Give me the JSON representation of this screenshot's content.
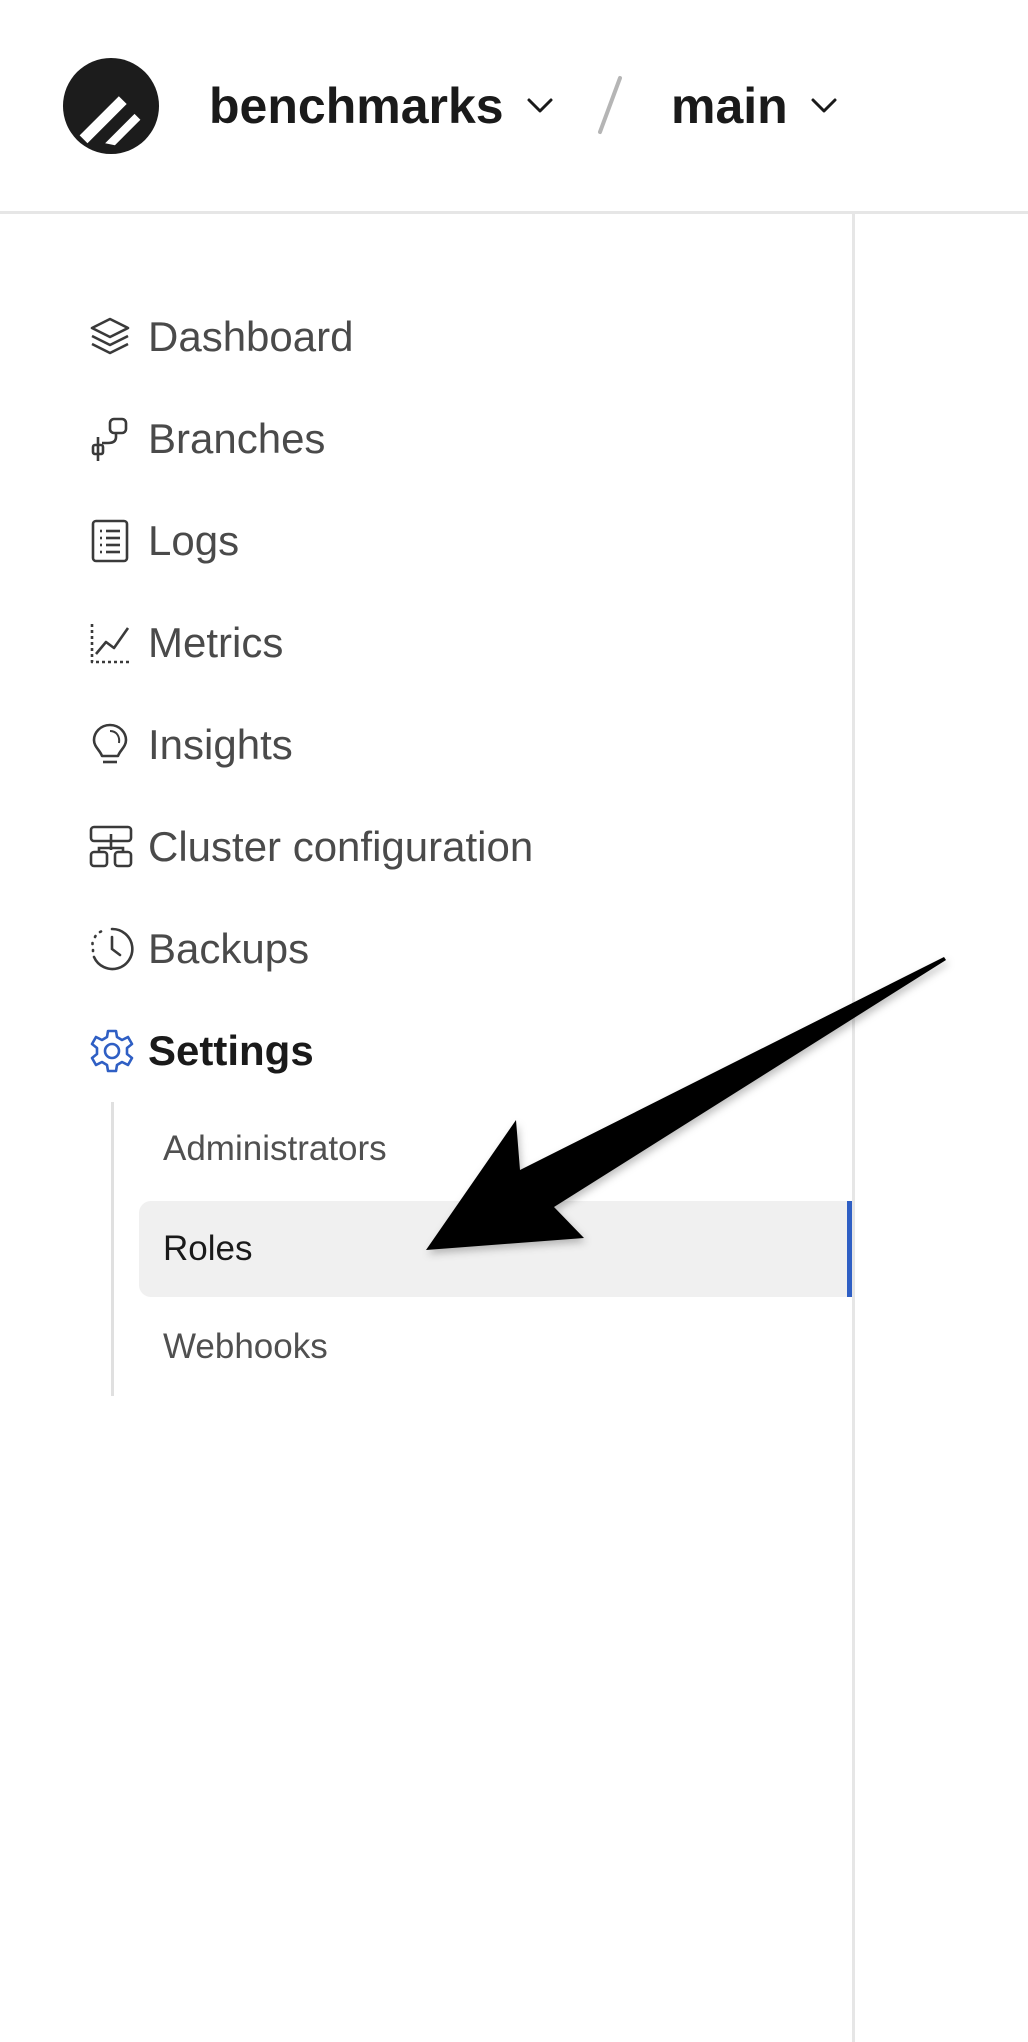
{
  "header": {
    "org_name": "benchmarks",
    "separator": "/",
    "branch_name": "main"
  },
  "sidebar": {
    "items": [
      {
        "label": "Dashboard",
        "icon": "layers-icon"
      },
      {
        "label": "Branches",
        "icon": "branch-icon"
      },
      {
        "label": "Logs",
        "icon": "document-list-icon"
      },
      {
        "label": "Metrics",
        "icon": "line-chart-icon"
      },
      {
        "label": "Insights",
        "icon": "lightbulb-icon"
      },
      {
        "label": "Cluster configuration",
        "icon": "cluster-icon"
      },
      {
        "label": "Backups",
        "icon": "clock-icon"
      },
      {
        "label": "Settings",
        "icon": "gear-icon",
        "active": true
      }
    ],
    "settings_subitems": [
      {
        "label": "Administrators"
      },
      {
        "label": "Roles",
        "selected": true
      },
      {
        "label": "Webhooks"
      }
    ]
  },
  "colors": {
    "accent": "#2f5fc4",
    "active_text": "#1a1a1a",
    "muted_text": "#4a4a4a",
    "selected_bg": "#f0f0f0",
    "divider": "#e6e6e6"
  }
}
